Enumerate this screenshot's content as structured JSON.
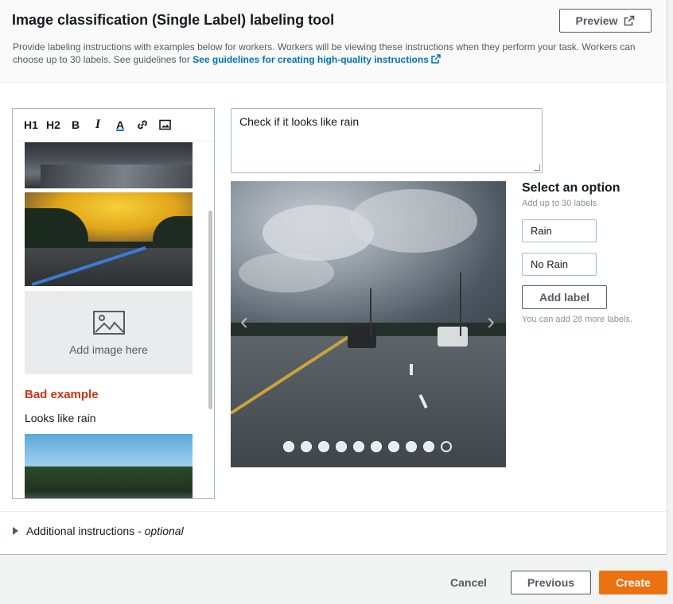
{
  "header": {
    "title": "Image classification (Single Label) labeling tool",
    "description": "Provide labeling instructions with examples below for workers. Workers will be viewing these instructions when they perform your task. Workers can choose up to 30 labels. See guidelines for",
    "guidelines_link": "See guidelines for creating high-quality instructions",
    "preview_label": "Preview"
  },
  "editor": {
    "toolbar": [
      "H1",
      "H2",
      "B",
      "I",
      "A"
    ],
    "placeholder_label": "Add image here",
    "bad_example_title": "Bad example",
    "bad_example_text": "Looks like rain"
  },
  "instruction_field": {
    "value": "Check if it looks like rain"
  },
  "carousel": {
    "dot_count": 10,
    "current_dot": 10
  },
  "options": {
    "title": "Select an option",
    "subtitle": "Add up to 30 labels",
    "labels": [
      "Rain",
      "No Rain"
    ],
    "add_label_button": "Add label",
    "remaining_note": "You can add 28 more labels."
  },
  "additional": {
    "label": "Additional instructions - ",
    "optional": "optional"
  },
  "footer": {
    "cancel": "Cancel",
    "previous": "Previous",
    "create": "Create"
  },
  "colors": {
    "accent": "#ec7211",
    "link": "#0073bb",
    "bad": "#d13212"
  }
}
